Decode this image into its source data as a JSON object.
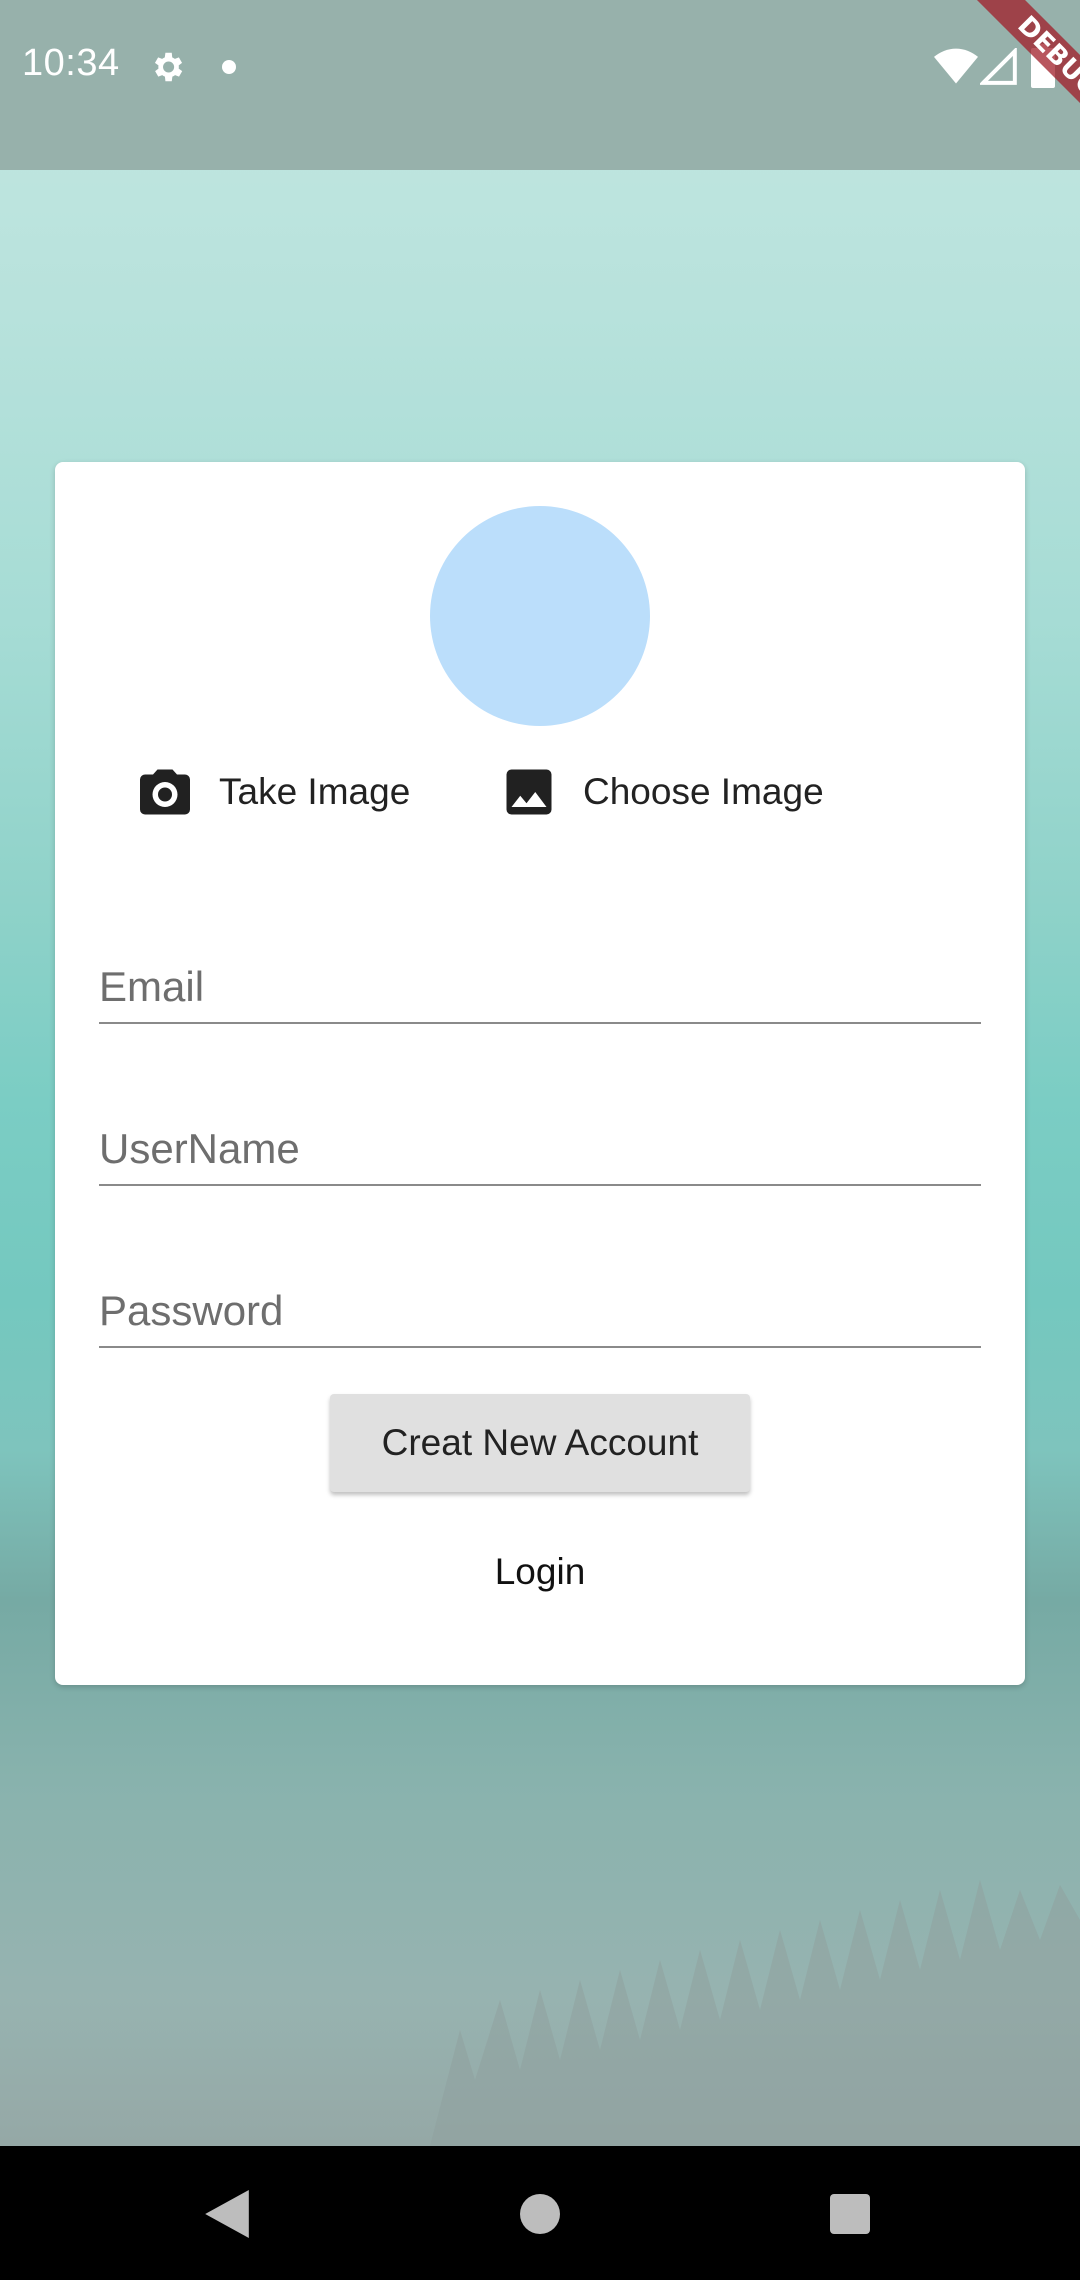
{
  "status_bar": {
    "time": "10:34",
    "debug_label": "DEBUG",
    "icons": [
      "gear-icon",
      "notification-dot-icon",
      "wifi-icon",
      "signal-icon",
      "battery-icon"
    ]
  },
  "card": {
    "avatar_color": "#bbdefb",
    "take_image": {
      "label": "Take Image",
      "icon": "camera-icon"
    },
    "choose_image": {
      "label": "Choose Image",
      "icon": "image-icon"
    },
    "fields": {
      "email": {
        "placeholder": "Email",
        "value": ""
      },
      "username": {
        "placeholder": "UserName",
        "value": ""
      },
      "password": {
        "placeholder": "Password",
        "value": ""
      }
    },
    "create_button_label": "Creat New Account",
    "login_label": "Login"
  },
  "nav_bar": {
    "icons": [
      "back-icon",
      "home-icon",
      "recent-apps-icon"
    ]
  },
  "colors": {
    "card_background": "#ffffff",
    "button_background": "#e0e0e0",
    "debug_ribbon": "#a01e28"
  }
}
